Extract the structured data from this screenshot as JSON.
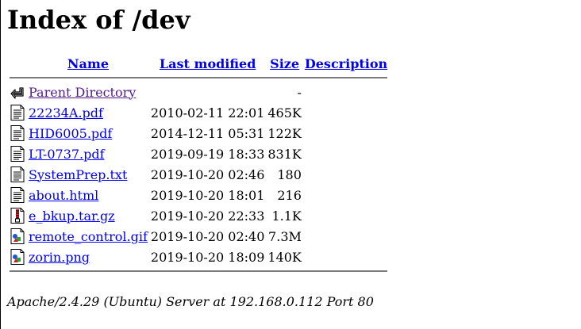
{
  "page": {
    "title": "Index of /dev"
  },
  "columns": {
    "name": "Name",
    "last_modified": "Last modified",
    "size": "Size",
    "description": "Description"
  },
  "entries": [
    {
      "icon": "back-icon",
      "name": "Parent Directory",
      "modified": "",
      "size": "-",
      "description": ""
    },
    {
      "icon": "text-file-icon",
      "name": "22234A.pdf",
      "modified": "2010-02-11 22:01",
      "size": "465K",
      "description": ""
    },
    {
      "icon": "text-file-icon",
      "name": "HID6005.pdf",
      "modified": "2014-12-11 05:31",
      "size": "122K",
      "description": ""
    },
    {
      "icon": "text-file-icon",
      "name": "LT-0737.pdf",
      "modified": "2019-09-19 18:33",
      "size": "831K",
      "description": ""
    },
    {
      "icon": "text-file-icon",
      "name": "SystemPrep.txt",
      "modified": "2019-10-20 02:46",
      "size": "180",
      "description": ""
    },
    {
      "icon": "text-file-icon",
      "name": "about.html",
      "modified": "2019-10-20 18:01",
      "size": "216",
      "description": ""
    },
    {
      "icon": "compressed-file-icon",
      "name": "e_bkup.tar.gz",
      "modified": "2019-10-20 22:33",
      "size": "1.1K",
      "description": ""
    },
    {
      "icon": "image-file-icon",
      "name": "remote_control.gif",
      "modified": "2019-10-20 02:40",
      "size": "7.3M",
      "description": ""
    },
    {
      "icon": "image-file-icon",
      "name": "zorin.png",
      "modified": "2019-10-20 18:09",
      "size": "140K",
      "description": ""
    }
  ],
  "footer": {
    "address": "Apache/2.4.29 (Ubuntu) Server at 192.168.0.112 Port 80"
  },
  "colors": {
    "link": "#0000ee",
    "visited_link": "#551a8b",
    "rule": "#7a7a7a"
  }
}
